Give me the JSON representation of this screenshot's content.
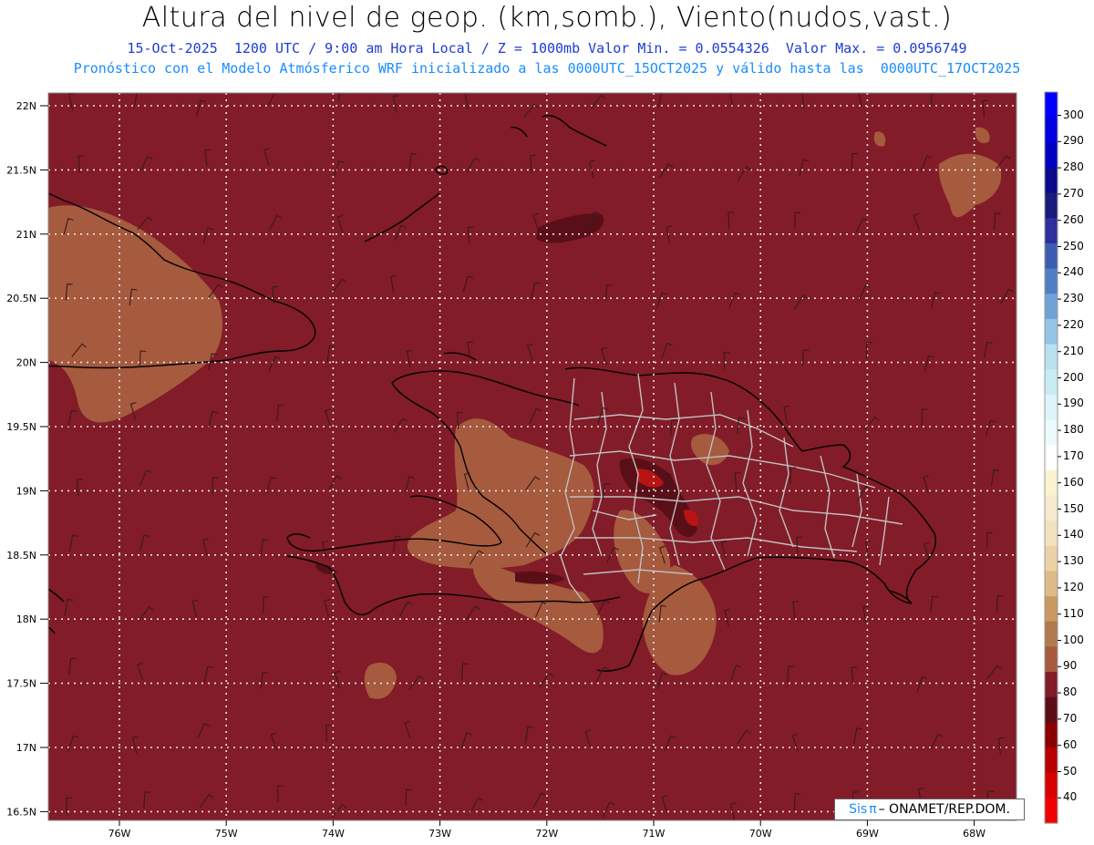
{
  "header": {
    "title": "Altura del nivel de geop. (km,somb.), Viento(nudos,vast.)",
    "subtitle": "15-Oct-2025  1200 UTC / 9:00 am Hora Local / Z = 1000mb Valor Min. = 0.0554326  Valor Max. = 0.0956749",
    "model_line": "Pronóstico con el Modelo Atmósferico WRF inicializado a las 0000UTC_15OCT2025 y válido hasta las  0000UTC_17OCT2025"
  },
  "map": {
    "lat_labels": [
      "22N",
      "21.5N",
      "21N",
      "20.5N",
      "20N",
      "19.5N",
      "19N",
      "18.5N",
      "18N",
      "17.5N",
      "17N",
      "16.5N"
    ],
    "lon_labels": [
      "76W",
      "75W",
      "74W",
      "73W",
      "72W",
      "71W",
      "70W",
      "69W",
      "68W"
    ],
    "background_color": "#821c28",
    "land_color": "#a65a3e",
    "high_color": "#5a0f18",
    "peak_color": "#b81414"
  },
  "colorbar": {
    "labels": [
      "300",
      "290",
      "280",
      "270",
      "260",
      "250",
      "240",
      "230",
      "220",
      "210",
      "200",
      "190",
      "180",
      "170",
      "160",
      "150",
      "140",
      "130",
      "120",
      "110",
      "100",
      "90",
      "80",
      "70",
      "60",
      "50",
      "40"
    ],
    "colors": [
      "#0000ff",
      "#0000e0",
      "#0000c0",
      "#0a0a8a",
      "#1a1a7a",
      "#2e2e9e",
      "#3e5db0",
      "#4f7fc2",
      "#6fa3d6",
      "#95c4e4",
      "#b8e0ee",
      "#c8ecf4",
      "#dff4fa",
      "#ecfafd",
      "#ffffff",
      "#fbf2cf",
      "#f7ead0",
      "#f3e2c0",
      "#ead1a6",
      "#deba86",
      "#c89a62",
      "#b07a4e",
      "#a65a3e",
      "#821c28",
      "#5a0f18",
      "#8a0000",
      "#b80000",
      "#d80000",
      "#f00000"
    ]
  },
  "footer": {
    "logo_prefix": "Sis",
    "logo_pi": "π",
    "logo_text": "– ONAMET/REP.DOM."
  }
}
